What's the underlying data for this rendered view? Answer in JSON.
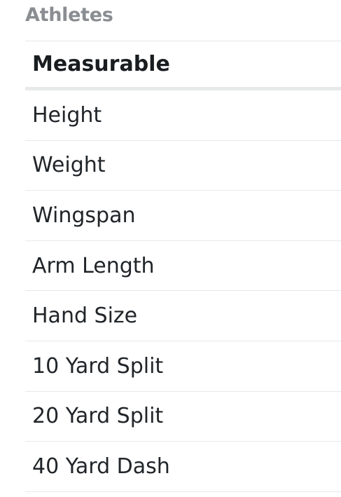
{
  "section": {
    "title": "Athletes"
  },
  "table": {
    "header": "Measurable",
    "rows": [
      "Height",
      "Weight",
      "Wingspan",
      "Arm Length",
      "Hand Size",
      "10 Yard Split",
      "20 Yard Split",
      "40 Yard Dash"
    ]
  }
}
